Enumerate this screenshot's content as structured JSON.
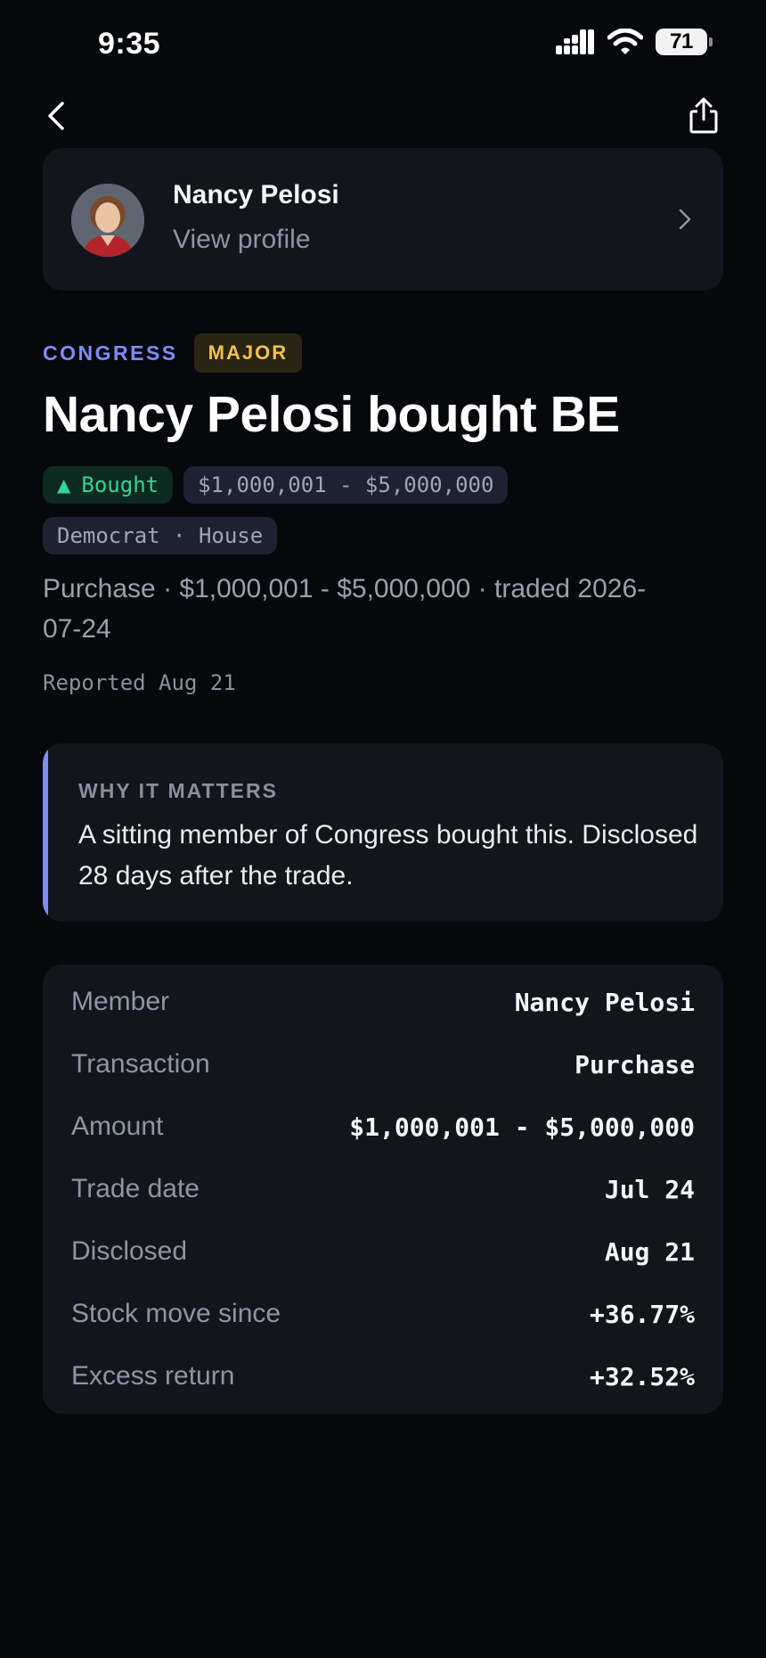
{
  "status_bar": {
    "time": "9:35",
    "battery": "71",
    "icons": [
      "signal-icon",
      "wifi-icon",
      "battery-icon"
    ]
  },
  "nav": {
    "back_icon": "chevron-left-icon",
    "share_icon": "share-icon"
  },
  "profile": {
    "name": "Nancy Pelosi",
    "link_label": "View profile",
    "chevron_icon": "chevron-right-icon"
  },
  "tags": {
    "category": "CONGRESS",
    "severity": "MAJOR"
  },
  "headline": "Nancy Pelosi bought BE",
  "pills": {
    "direction": "Bought",
    "amount": "$1,000,001 - $5,000,000",
    "party_chamber": "Democrat · House"
  },
  "summary": "Purchase · $1,000,001 - $5,000,000 · traded 2026-07-24",
  "reported": "Reported Aug 21",
  "why_it_matters": {
    "title": "WHY IT MATTERS",
    "body": "A sitting member of Congress bought this. Disclosed 28 days after the trade."
  },
  "details": [
    {
      "label": "Member",
      "value": "Nancy Pelosi"
    },
    {
      "label": "Transaction",
      "value": "Purchase"
    },
    {
      "label": "Amount",
      "value": "$1,000,001 - $5,000,000"
    },
    {
      "label": "Trade date",
      "value": "Jul 24"
    },
    {
      "label": "Disclosed",
      "value": "Aug 21"
    },
    {
      "label": "Stock move since",
      "value": "+36.77%"
    },
    {
      "label": "Excess return",
      "value": "+32.52%"
    }
  ],
  "colors": {
    "background": "#07080c",
    "card": "#13151d",
    "accent": "#7f8cf6",
    "major": "#f3c14e",
    "bought": "#34d399"
  }
}
